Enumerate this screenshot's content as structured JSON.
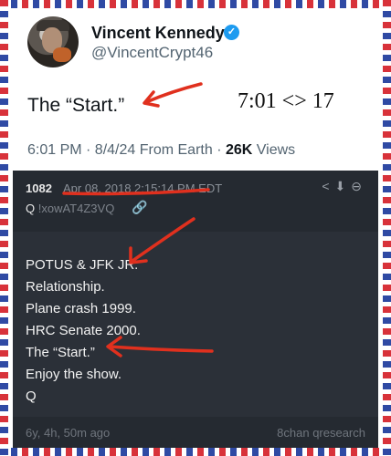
{
  "tweet": {
    "name": "Vincent Kennedy",
    "handle": "@VincentCrypt46",
    "text": "The “Start.”",
    "note": "7:01 <> 17",
    "time": "6:01 PM · 8/4/24 From Earth · ",
    "views_count": "26K",
    "views_label": " Views"
  },
  "qpost": {
    "number": "1082",
    "date": "Apr 08, 2018 2:15:14 PM EDT",
    "author_q": "Q",
    "tripcode": "!xowAT4Z3VQ",
    "lines": [
      "POTUS & JFK JR.",
      "Relationship.",
      "Plane crash 1999.",
      "HRC Senate 2000.",
      "The “Start.”",
      "Enjoy the show.",
      "Q"
    ],
    "age": "6y, 4h, 50m ago",
    "source": "8chan qresearch"
  },
  "colors": {
    "stripe_red": "#d8323a",
    "stripe_blue": "#2f4aa4",
    "annotation_red": "#e0301e",
    "verified": "#1d9bf0"
  },
  "icons": [
    "verified-badge-icon",
    "link-icon",
    "share-icon",
    "download-icon",
    "close-icon"
  ]
}
